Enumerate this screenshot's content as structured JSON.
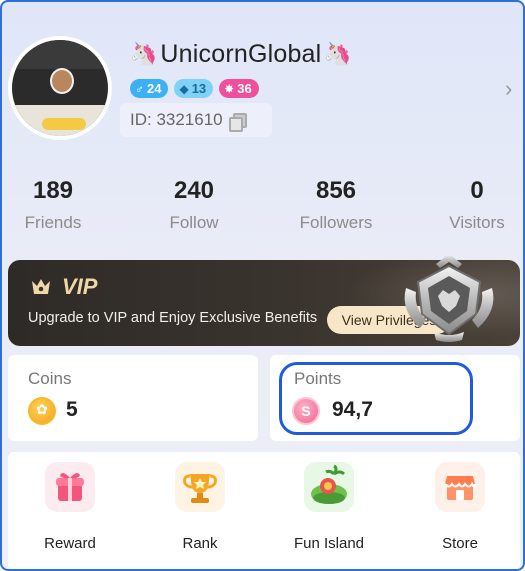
{
  "profile": {
    "username": "UnicornGlobal",
    "unicorn_emoji": "🦄",
    "badges": {
      "gender_level": "24",
      "level": "13",
      "rank": "36"
    },
    "id_text": "ID: 3321610"
  },
  "stats": [
    {
      "value": "189",
      "label": "Friends"
    },
    {
      "value": "240",
      "label": "Follow"
    },
    {
      "value": "856",
      "label": "Followers"
    },
    {
      "value": "0",
      "label": "Visitors"
    }
  ],
  "vip": {
    "title": "VIP",
    "description": "Upgrade to VIP and Enjoy Exclusive Benefits",
    "button": "View Privileges"
  },
  "wallet": {
    "coins_label": "Coins",
    "coins_value": "5",
    "points_label": "Points",
    "points_value": "94,7",
    "points_symbol": "S"
  },
  "shortcuts": [
    {
      "label": "Reward",
      "icon": "gift-icon"
    },
    {
      "label": "Rank",
      "icon": "trophy-icon"
    },
    {
      "label": "Fun Island",
      "icon": "island-icon"
    },
    {
      "label": "Store",
      "icon": "store-icon"
    }
  ],
  "colors": {
    "highlight": "#1f5ae0",
    "vip_gold": "#f1d7a8",
    "rank_badge": "#ef4f9d",
    "gender_badge": "#3bb1f3"
  }
}
